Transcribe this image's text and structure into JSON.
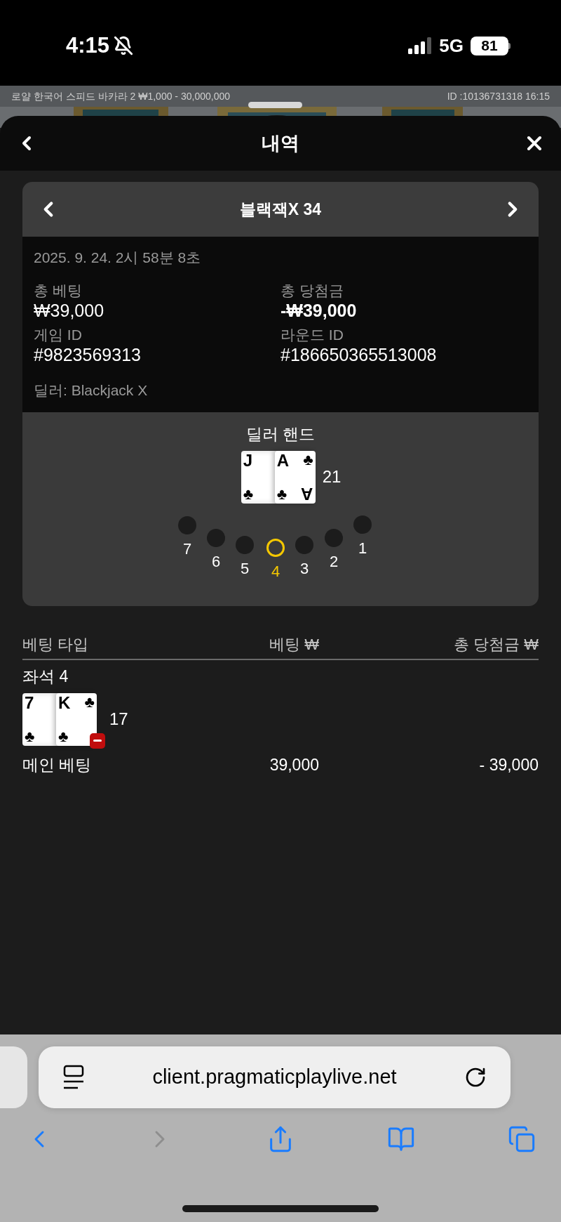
{
  "status_bar": {
    "time": "4:15",
    "network": "5G",
    "battery": "81"
  },
  "background_table": {
    "title": "로얄 한국어 스피드 바카라 2 ₩1,000 - 30,000,000",
    "id": "ID :10136731318 16:15"
  },
  "sheet": {
    "title": "내역"
  },
  "round_card": {
    "title": "블랙잭X 34",
    "date": "2025. 9. 24. 2시 58분 8초",
    "fields": [
      {
        "label": "총 베팅",
        "value": "₩39,000",
        "bold": false
      },
      {
        "label": "총 당첨금",
        "value": "-₩39,000",
        "bold": true
      },
      {
        "label": "게임 ID",
        "value": "#9823569313",
        "bold": false
      },
      {
        "label": "라운드 ID",
        "value": "#186650365513008",
        "bold": false
      }
    ],
    "dealer_name": "딜러: Blackjack X",
    "dealer_hand": {
      "title": "딜러 핸드",
      "total": "21",
      "cards": [
        {
          "top_rank": "J",
          "bottom_suit": "♣"
        },
        {
          "top_rank": "A",
          "top_suit": "♣",
          "bottom_suit": "♣",
          "bottom_rank": "A"
        }
      ]
    },
    "seats": [
      {
        "label": "7",
        "selected": false
      },
      {
        "label": "6",
        "selected": false
      },
      {
        "label": "5",
        "selected": false
      },
      {
        "label": "4",
        "selected": true
      },
      {
        "label": "3",
        "selected": false
      },
      {
        "label": "2",
        "selected": false
      },
      {
        "label": "1",
        "selected": false
      }
    ]
  },
  "bet_table": {
    "columns": [
      "베팅 타입",
      "베팅 ₩",
      "총 당첨금 ₩"
    ],
    "seats": [
      {
        "label": "좌석 4",
        "hand": {
          "total": "17",
          "lost": true,
          "cards": [
            {
              "top_rank": "7",
              "bottom_suit": "♣"
            },
            {
              "top_rank": "K",
              "top_suit": "♣",
              "bottom_suit": "♣"
            }
          ]
        },
        "bets": [
          {
            "type": "메인 베팅",
            "bet": "39,000",
            "win": "- 39,000"
          }
        ]
      }
    ]
  },
  "browser": {
    "url": "client.pragmaticplaylive.net",
    "toolbar": [
      {
        "kind": "back",
        "disabled": false
      },
      {
        "kind": "forward",
        "disabled": true
      },
      {
        "kind": "share",
        "disabled": false
      },
      {
        "kind": "bookmarks",
        "disabled": false
      },
      {
        "kind": "tabs",
        "disabled": false
      }
    ]
  }
}
